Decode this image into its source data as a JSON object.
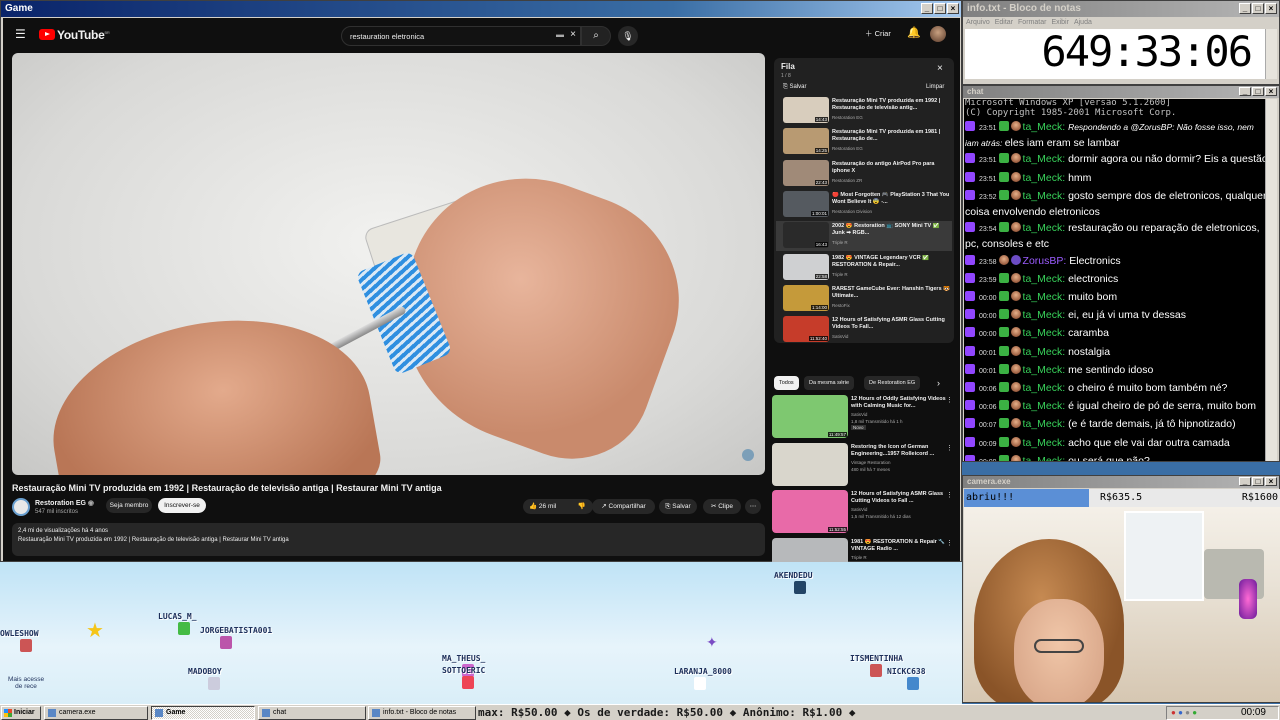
{
  "game_window": {
    "title": "Game"
  },
  "youtube": {
    "logo": "YouTube",
    "logo_region": "BR",
    "search_value": "restauration eletronica",
    "create_label": "Criar",
    "video_title": "Restauração Mini TV produzida em 1992 | Restauração de televisão antiga | Restaurar Mini TV antiga",
    "channel": {
      "name": "Restoration EG",
      "subs": "547 mil inscritos",
      "member_label": "Seja membro",
      "subscribe_label": "Inscrever-se"
    },
    "actions": {
      "likes": "26 mil",
      "share": "Compartilhar",
      "save": "Salvar",
      "clip": "Clipe"
    },
    "description": {
      "stats": "2,4 mi de visualizações  há 4 anos",
      "text": "Restauração Mini TV produzida em 1992 | Restauração de televisão antiga | Restaurar Mini TV antiga"
    },
    "queue": {
      "title": "Fila",
      "count": "1 / 8",
      "save": "Salvar",
      "clear": "Limpar",
      "items": [
        {
          "title": "Restauração Mini TV produzida em 1992 | Restauração de televisão antig...",
          "channel": "Restoration EG",
          "duration": "14:43",
          "color": "#d8cdbd"
        },
        {
          "title": "Restauração Mini TV produzida em 1981 | Restauração de...",
          "channel": "Restoration EG",
          "duration": "14:25",
          "color": "#b89a72"
        },
        {
          "title": "Restauração do antigo AirPod Pro para iphone X",
          "channel": "Restoration ZR",
          "duration": "22:43",
          "color": "#a08a78"
        },
        {
          "title": "🔴 Most Forgotten 🎮 PlayStation 3 That You Wont Believe It 😨 -...",
          "channel": "Restoration Division",
          "duration": "1:00:01",
          "color": "#555a60"
        },
        {
          "title": "2002 😍 Restoration 📺 SONY Mini TV ✅ Junk ➡ RGB...",
          "channel": "Triple R",
          "duration": "16:43",
          "color": "#2a2a2a"
        },
        {
          "title": "1982 😍 VINTAGE Legendary VCR ✅ RESTORATION & Repair...",
          "channel": "Triple R",
          "duration": "22:58",
          "color": "#cfd0d2"
        },
        {
          "title": "RAREST GameCube Ever: Hanshin Tigers 🐯 Ultimate...",
          "channel": "RestoFix",
          "duration": "1:14:00",
          "color": "#c59a3a"
        },
        {
          "title": "12 Hours of Satisfying ASMR Glass Cutting Videos To Fall...",
          "channel": "SatisVid",
          "duration": "11:52:40",
          "color": "#c63c2a"
        }
      ]
    },
    "chips": [
      "Todos",
      "Da mesma série",
      "De Restoration EG"
    ],
    "recommendations": [
      {
        "title": "12 Hours of Oddly Satisfying Videos with Calming Music for...",
        "channel": "SatisVid",
        "meta": "1,8 mil  Transmitido há 1 h",
        "badge": "Novo",
        "duration": "11:49:57",
        "color": "#7ec870"
      },
      {
        "title": "Restoring the Icon of German Engineering...1957 Rolleicord ...",
        "channel": "Vintage Restoration",
        "meta": "480 mil  há 7 meses",
        "badge": "",
        "duration": "",
        "color": "#d9d6cc"
      },
      {
        "title": "12 Hours of Satisfying ASMR Glass Cutting Videos to Fall ...",
        "channel": "SatisVid",
        "meta": "1,5 mil  Transmitido há 12 dias",
        "badge": "",
        "duration": "11:52:55",
        "color": "#e86aa8"
      },
      {
        "title": "1981 😍 RESTORATION & Repair 🔧 VINTAGE Radio ...",
        "channel": "Triple R",
        "meta": "1,1 mi  há 6 meses",
        "badge": "",
        "duration": "",
        "color": "#b7b9bb"
      }
    ]
  },
  "arena": {
    "users": [
      {
        "name": "OWLESHOW"
      },
      {
        "name": "LUCAS_M_"
      },
      {
        "name": "JORGEBATISTA001"
      },
      {
        "name": "MADOBOY"
      },
      {
        "name": "MA_THEUS_"
      },
      {
        "name": "SOTTOERIC"
      },
      {
        "name": "AKENDEDU"
      },
      {
        "name": "LARANJA_8000"
      },
      {
        "name": "ITSMENTINHA"
      },
      {
        "name": "NICKC638"
      }
    ],
    "note": "Mais acesse de rece"
  },
  "notepad": {
    "title": "info.txt - Bloco de notas",
    "menu": [
      "Arquivo",
      "Editar",
      "Formatar",
      "Exibir",
      "Ajuda"
    ],
    "timer": "649:33:06"
  },
  "chat": {
    "title": "chat",
    "header_lines": [
      "Microsoft Windows XP [versão 5.1.2600]",
      "(C) Copyright 1985-2001 Microsoft Corp."
    ],
    "messages": [
      {
        "time": "23:51",
        "user": "ta_Meck",
        "text": "Respondendo a @ZorusBP: Não fosse isso, nem iam atrás: ",
        "text2": "eles iam eram se lambar",
        "style": "reply"
      },
      {
        "time": "23:51",
        "user": "ta_Meck",
        "text": "dormir agora ou não dormir? Eis a questão"
      },
      {
        "time": "23:51",
        "user": "ta_Meck",
        "text": "hmm"
      },
      {
        "time": "23:52",
        "user": "ta_Meck",
        "text": "gosto sempre dos de eletronicos, qualquer coisa envolvendo eletronicos"
      },
      {
        "time": "23:54",
        "user": "ta_Meck",
        "text": "restauração ou reparação de eletronicos, pc, consoles e etc"
      },
      {
        "time": "23:58",
        "user": "ZorusBP",
        "text": "Electronics"
      },
      {
        "time": "23:59",
        "user": "ta_Meck",
        "text": "electronics"
      },
      {
        "time": "00:00",
        "user": "ta_Meck",
        "text": "muito bom"
      },
      {
        "time": "00:00",
        "user": "ta_Meck",
        "text": "ei, eu já vi uma tv dessas"
      },
      {
        "time": "00:00",
        "user": "ta_Meck",
        "text": "caramba"
      },
      {
        "time": "00:01",
        "user": "ta_Meck",
        "text": "nostalgia"
      },
      {
        "time": "00:01",
        "user": "ta_Meck",
        "text": "me sentindo idoso"
      },
      {
        "time": "00:06",
        "user": "ta_Meck",
        "text": "o cheiro é muito bom também né?"
      },
      {
        "time": "00:06",
        "user": "ta_Meck",
        "text": "é igual cheiro de pó de serra, muito bom"
      },
      {
        "time": "00:07",
        "user": "ta_Meck",
        "text": "(e é tarde demais, já tô hipnotizado)"
      },
      {
        "time": "00:09",
        "user": "ta_Meck",
        "text": "acho que ele vai dar outra camada"
      },
      {
        "time": "00:09",
        "user": "ta_Meck",
        "text": "ou será que não?"
      }
    ]
  },
  "camera": {
    "title": "camera.exe",
    "goal_label": "abriu!!!",
    "goal_current": "R$635.5",
    "goal_target": "R$1600",
    "progress": 0.397
  },
  "taskbar": {
    "start": "Iniciar",
    "tasks": [
      {
        "label": "camera.exe",
        "active": false
      },
      {
        "label": "Game",
        "active": true
      },
      {
        "label": "chat",
        "active": false
      },
      {
        "label": "info.txt - Bloco de notas",
        "active": false
      }
    ],
    "ticker": "max: R$50.00  ◆  Os de verdade: R$50.00  ◆  Anônimo: R$1.00  ◆",
    "clock": "00:09"
  }
}
